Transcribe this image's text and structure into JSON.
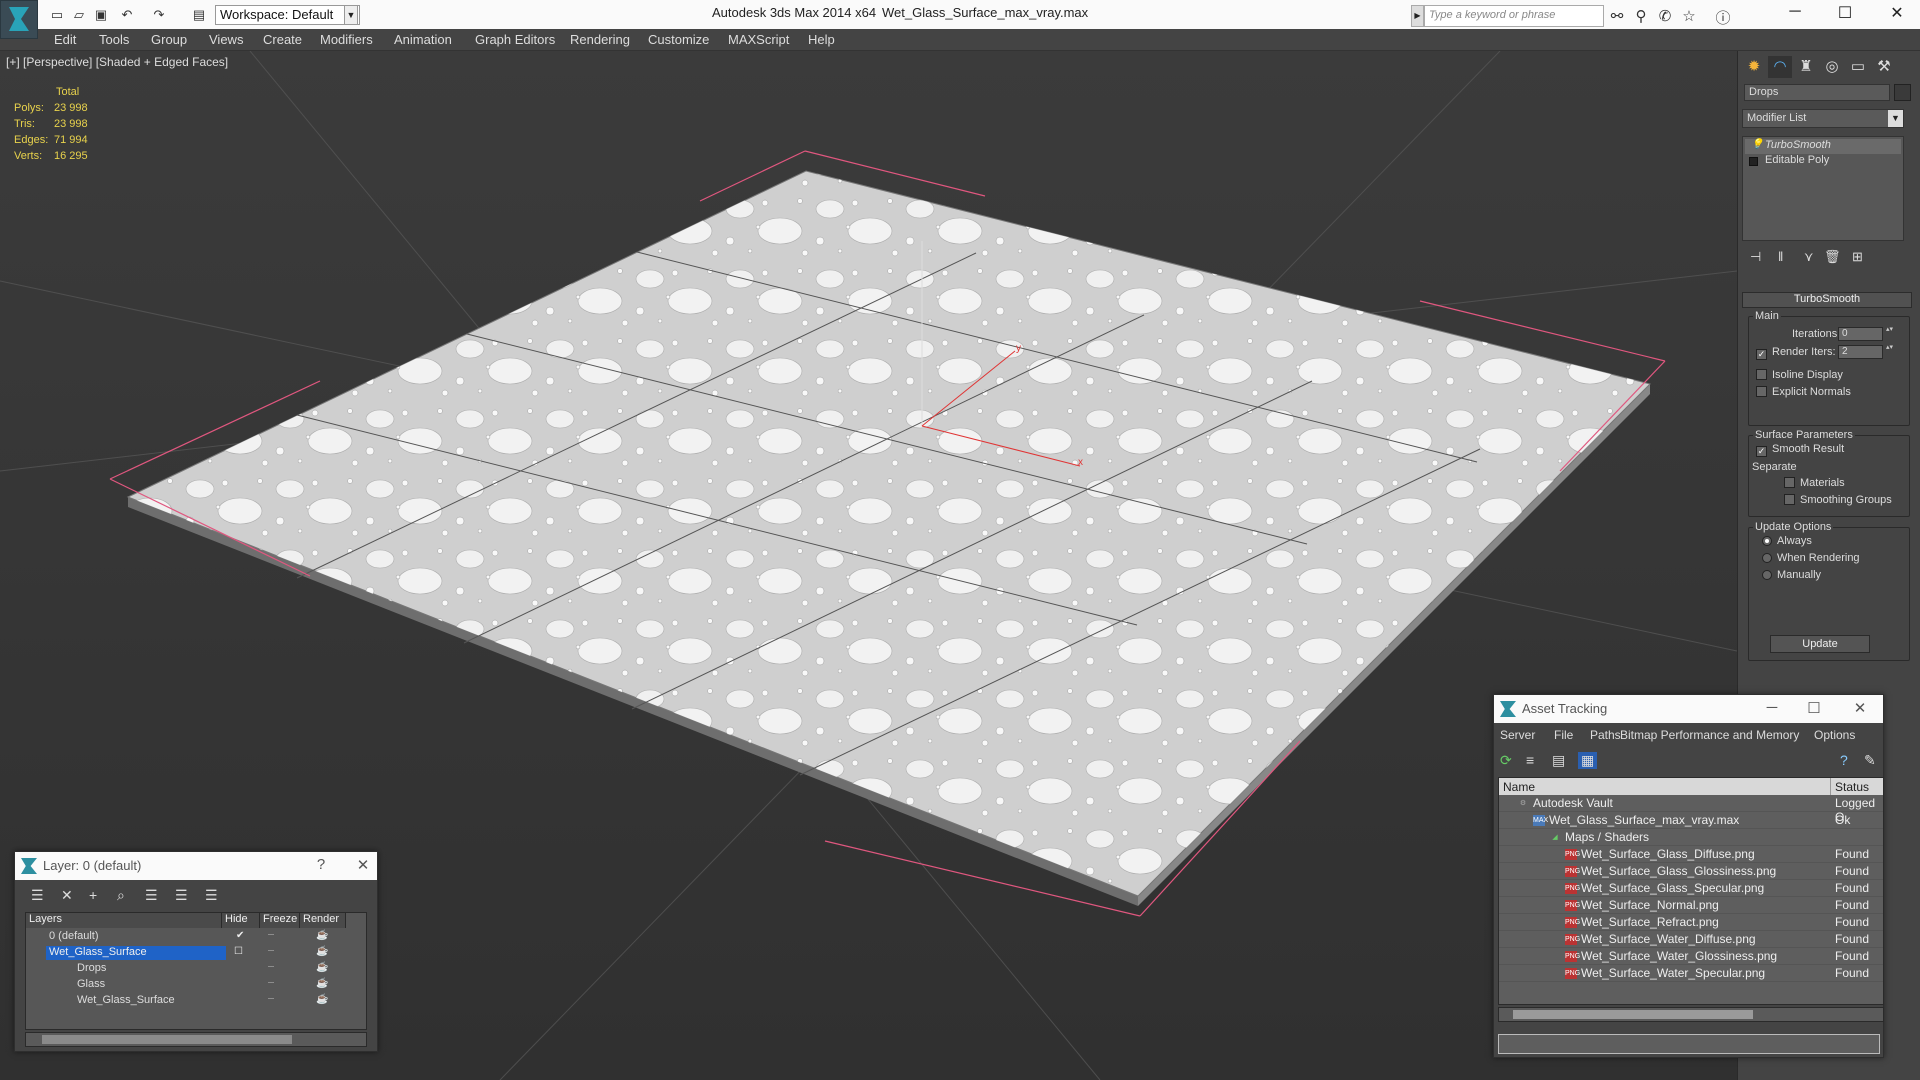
{
  "titlebar": {
    "workspace": "Workspace: Default",
    "app_title": "Autodesk 3ds Max  2014 x64",
    "file_title": "Wet_Glass_Surface_max_vray.max",
    "search_placeholder": "Type a keyword or phrase"
  },
  "menu": [
    "Edit",
    "Tools",
    "Group",
    "Views",
    "Create",
    "Modifiers",
    "Animation",
    "Graph Editors",
    "Rendering",
    "Customize",
    "MAXScript",
    "Help"
  ],
  "viewport": {
    "label": "[+] [Perspective] [Shaded + Edged Faces]",
    "stats": {
      "header": "Total",
      "rows": [
        {
          "label": "Polys:",
          "value": "23 998"
        },
        {
          "label": "Tris:",
          "value": "23 998"
        },
        {
          "label": "Edges:",
          "value": "71 994"
        },
        {
          "label": "Verts:",
          "value": "16 295"
        }
      ]
    },
    "gizmo": {
      "x": "x",
      "y": "y"
    }
  },
  "command_panel": {
    "object_name": "Drops",
    "modifier_list": "Modifier List",
    "stack": [
      "TurboSmooth",
      "Editable Poly"
    ],
    "rollout_title": "TurboSmooth",
    "main_group": "Main",
    "iterations_label": "Iterations:",
    "iterations_value": "0",
    "render_iters_label": "Render Iters:",
    "render_iters_value": "2",
    "render_iters_checked": true,
    "isoline_display": "Isoline Display",
    "explicit_normals": "Explicit Normals",
    "surface_params": "Surface Parameters",
    "smooth_result": "Smooth Result",
    "separate": "Separate",
    "materials": "Materials",
    "smoothing_groups": "Smoothing Groups",
    "update_options": "Update Options",
    "always": "Always",
    "when_rendering": "When Rendering",
    "manually": "Manually",
    "update_button": "Update"
  },
  "layer_window": {
    "title": "Layer: 0 (default)",
    "help": "?",
    "columns": [
      "Layers",
      "Hide",
      "Freeze",
      "Render"
    ],
    "rows": [
      "0 (default)",
      "Wet_Glass_Surface",
      "Drops",
      "Glass",
      "Wet_Glass_Surface"
    ]
  },
  "asset_window": {
    "title": "Asset Tracking",
    "menu": [
      "Server",
      "File",
      "Paths",
      "Bitmap Performance and Memory",
      "Options"
    ],
    "columns": [
      "Name",
      "Status"
    ],
    "rows": [
      {
        "name": "Autodesk Vault",
        "status": "Logged O"
      },
      {
        "name": "Wet_Glass_Surface_max_vray.max",
        "status": "Ok"
      },
      {
        "name": "Maps / Shaders",
        "status": ""
      },
      {
        "name": "Wet_Surface_Glass_Diffuse.png",
        "status": "Found"
      },
      {
        "name": "Wet_Surface_Glass_Glossiness.png",
        "status": "Found"
      },
      {
        "name": "Wet_Surface_Glass_Specular.png",
        "status": "Found"
      },
      {
        "name": "Wet_Surface_Normal.png",
        "status": "Found"
      },
      {
        "name": "Wet_Surface_Refract.png",
        "status": "Found"
      },
      {
        "name": "Wet_Surface_Water_Diffuse.png",
        "status": "Found"
      },
      {
        "name": "Wet_Surface_Water_Glossiness.png",
        "status": "Found"
      },
      {
        "name": "Wet_Surface_Water_Specular.png",
        "status": "Found"
      }
    ]
  },
  "colors": {
    "accent": "#1f63c7",
    "stats": "#e8d24c",
    "bbox": "#e0577f"
  }
}
